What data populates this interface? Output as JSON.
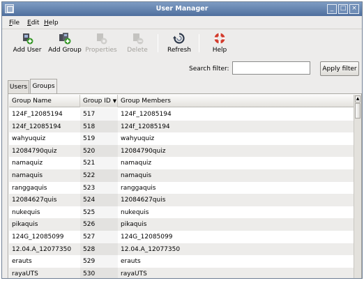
{
  "window": {
    "title": "User Manager"
  },
  "menubar": {
    "file": "File",
    "edit": "Edit",
    "help": "Help"
  },
  "toolbar": {
    "add_user": "Add User",
    "add_group": "Add Group",
    "properties": "Properties",
    "delete": "Delete",
    "refresh": "Refresh",
    "help": "Help"
  },
  "search": {
    "label": "Search filter:",
    "value": "",
    "apply": "Apply filter"
  },
  "tabs": {
    "users": "Users",
    "groups": "Groups",
    "active": "Groups"
  },
  "table": {
    "columns": [
      "Group Name",
      "Group ID",
      "Group Members"
    ],
    "sort_indicator": "▼",
    "rows": [
      [
        "124F_12085194",
        "517",
        "124F_12085194"
      ],
      [
        "124f_12085194",
        "518",
        "124f_12085194"
      ],
      [
        "wahyuquiz",
        "519",
        "wahyuquiz"
      ],
      [
        "12084790quiz",
        "520",
        "12084790quiz"
      ],
      [
        "namaquiz",
        "521",
        "namaquiz"
      ],
      [
        "namaquis",
        "522",
        "namaquis"
      ],
      [
        "ranggaquis",
        "523",
        "ranggaquis"
      ],
      [
        "12084627quis",
        "524",
        "12084627quis"
      ],
      [
        "nukequis",
        "525",
        "nukequis"
      ],
      [
        "pikaquis",
        "526",
        "pikaquis"
      ],
      [
        "124G_12085099",
        "527",
        "124G_12085099"
      ],
      [
        "12.04.A_12077350",
        "528",
        "12.04.A_12077350"
      ],
      [
        "erauts",
        "529",
        "erauts"
      ],
      [
        "rayaUTS",
        "530",
        "rayaUTS"
      ]
    ]
  },
  "icons": {
    "add_user": "add-user-icon",
    "add_group": "add-group-icon",
    "properties": "properties-icon",
    "delete": "delete-icon",
    "refresh": "refresh-icon",
    "help": "help-lifebuoy-icon"
  },
  "colors": {
    "titlebar": "#5f7fab",
    "row_alt": "#edecea",
    "accent_green": "#3c9a2e",
    "help_red": "#d23b2c"
  }
}
